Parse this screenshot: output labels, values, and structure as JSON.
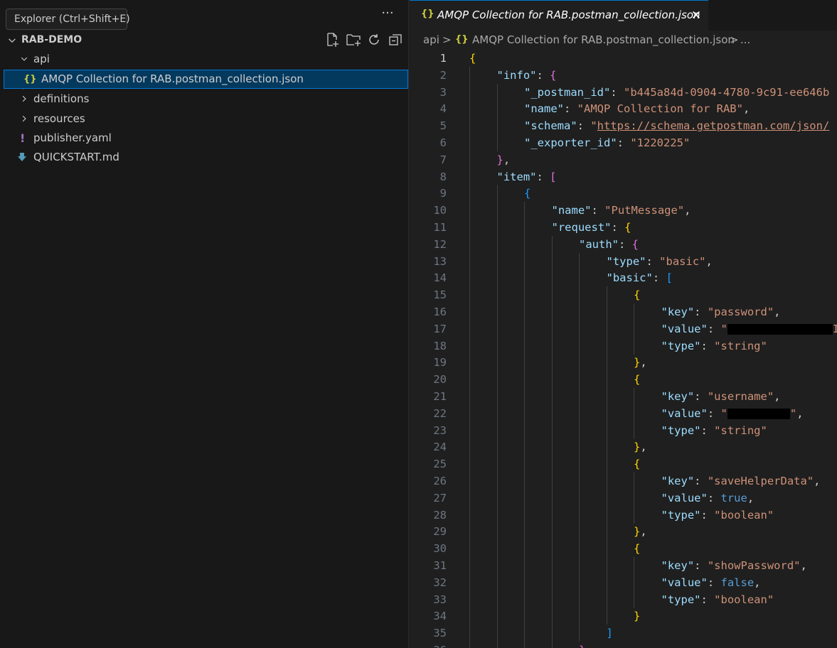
{
  "sidebar": {
    "tooltip": "Explorer (Ctrl+Shift+E)",
    "more_actions": "···",
    "section_title": "RAB-DEMO",
    "toolbar_icons": [
      "new-file-icon",
      "new-folder-icon",
      "refresh-icon",
      "collapse-all-icon"
    ],
    "tree": [
      {
        "label": "api",
        "kind": "folder",
        "expanded": true
      },
      {
        "label": "AMQP Collection for RAB.postman_collection.json",
        "kind": "json-file",
        "selected": true
      },
      {
        "label": "definitions",
        "kind": "folder",
        "expanded": false
      },
      {
        "label": "resources",
        "kind": "folder",
        "expanded": false
      },
      {
        "label": "publisher.yaml",
        "kind": "yaml-file"
      },
      {
        "label": "QUICKSTART.md",
        "kind": "markdown-file"
      }
    ]
  },
  "editor": {
    "tab": {
      "label": "AMQP Collection for RAB.postman_collection.json",
      "close": "✕",
      "icon": "{}"
    },
    "breadcrumb": {
      "folder": "api",
      "sep": ">",
      "file": "AMQP Collection for RAB.postman_collection.json",
      "ellipsis": "..."
    },
    "current_line": 1,
    "lines": [
      [
        [
          "{",
          "b1"
        ]
      ],
      [
        [
          "\"info\"",
          "k"
        ],
        [
          ": ",
          "p"
        ],
        [
          "{",
          "b2"
        ]
      ],
      [
        [
          "\"_postman_id\"",
          "k"
        ],
        [
          ": ",
          "p"
        ],
        [
          "\"b445a84d-0904-4780-9c91-ee646b",
          "s"
        ]
      ],
      [
        [
          "\"name\"",
          "k"
        ],
        [
          ": ",
          "p"
        ],
        [
          "\"AMQP Collection for RAB\"",
          "s"
        ],
        [
          ",",
          "p"
        ]
      ],
      [
        [
          "\"schema\"",
          "k"
        ],
        [
          ": ",
          "p"
        ],
        [
          "\"",
          "s"
        ],
        [
          "https://schema.getpostman.com/json/",
          "url"
        ]
      ],
      [
        [
          "\"_exporter_id\"",
          "k"
        ],
        [
          ": ",
          "p"
        ],
        [
          "\"1220225\"",
          "s"
        ]
      ],
      [
        [
          "}",
          "b2"
        ],
        [
          ",",
          "p"
        ]
      ],
      [
        [
          "\"item\"",
          "k"
        ],
        [
          ": ",
          "p"
        ],
        [
          "[",
          "b2"
        ]
      ],
      [
        [
          "{",
          "b3"
        ]
      ],
      [
        [
          "\"name\"",
          "k"
        ],
        [
          ": ",
          "p"
        ],
        [
          "\"PutMessage\"",
          "s"
        ],
        [
          ",",
          "p"
        ]
      ],
      [
        [
          "\"request\"",
          "k"
        ],
        [
          ": ",
          "p"
        ],
        [
          "{",
          "b1"
        ]
      ],
      [
        [
          "\"auth\"",
          "k"
        ],
        [
          ": ",
          "p"
        ],
        [
          "{",
          "b2"
        ]
      ],
      [
        [
          "\"type\"",
          "k"
        ],
        [
          ": ",
          "p"
        ],
        [
          "\"basic\"",
          "s"
        ],
        [
          ",",
          "p"
        ]
      ],
      [
        [
          "\"basic\"",
          "k"
        ],
        [
          ": ",
          "p"
        ],
        [
          "[",
          "b3"
        ]
      ],
      [
        [
          "{",
          "b1"
        ]
      ],
      [
        [
          "\"key\"",
          "k"
        ],
        [
          ": ",
          "p"
        ],
        [
          "\"password\"",
          "s"
        ],
        [
          ",",
          "p"
        ]
      ],
      [
        [
          "\"value\"",
          "k"
        ],
        [
          ": ",
          "p"
        ],
        [
          "\"",
          "s"
        ],
        [
          "REDACT_LONG",
          "redact"
        ],
        [
          "I",
          "s"
        ]
      ],
      [
        [
          "\"type\"",
          "k"
        ],
        [
          ": ",
          "p"
        ],
        [
          "\"string\"",
          "s"
        ]
      ],
      [
        [
          "}",
          "b1"
        ],
        [
          ",",
          "p"
        ]
      ],
      [
        [
          "{",
          "b1"
        ]
      ],
      [
        [
          "\"key\"",
          "k"
        ],
        [
          ": ",
          "p"
        ],
        [
          "\"username\"",
          "s"
        ],
        [
          ",",
          "p"
        ]
      ],
      [
        [
          "\"value\"",
          "k"
        ],
        [
          ": ",
          "p"
        ],
        [
          "\"",
          "s"
        ],
        [
          "REDACT_SHORT",
          "redact"
        ],
        [
          "\"",
          "s"
        ],
        [
          ",",
          "p"
        ]
      ],
      [
        [
          "\"type\"",
          "k"
        ],
        [
          ": ",
          "p"
        ],
        [
          "\"string\"",
          "s"
        ]
      ],
      [
        [
          "}",
          "b1"
        ],
        [
          ",",
          "p"
        ]
      ],
      [
        [
          "{",
          "b1"
        ]
      ],
      [
        [
          "\"key\"",
          "k"
        ],
        [
          ": ",
          "p"
        ],
        [
          "\"saveHelperData\"",
          "s"
        ],
        [
          ",",
          "p"
        ]
      ],
      [
        [
          "\"value\"",
          "k"
        ],
        [
          ": ",
          "p"
        ],
        [
          "true",
          "kw"
        ],
        [
          ",",
          "p"
        ]
      ],
      [
        [
          "\"type\"",
          "k"
        ],
        [
          ": ",
          "p"
        ],
        [
          "\"boolean\"",
          "s"
        ]
      ],
      [
        [
          "}",
          "b1"
        ],
        [
          ",",
          "p"
        ]
      ],
      [
        [
          "{",
          "b1"
        ]
      ],
      [
        [
          "\"key\"",
          "k"
        ],
        [
          ": ",
          "p"
        ],
        [
          "\"showPassword\"",
          "s"
        ],
        [
          ",",
          "p"
        ]
      ],
      [
        [
          "\"value\"",
          "k"
        ],
        [
          ": ",
          "p"
        ],
        [
          "false",
          "kw"
        ],
        [
          ",",
          "p"
        ]
      ],
      [
        [
          "\"type\"",
          "k"
        ],
        [
          ": ",
          "p"
        ],
        [
          "\"boolean\"",
          "s"
        ]
      ],
      [
        [
          "}",
          "b1"
        ]
      ],
      [
        [
          "]",
          "b3"
        ]
      ],
      [
        [
          "}",
          "b2"
        ]
      ]
    ]
  }
}
